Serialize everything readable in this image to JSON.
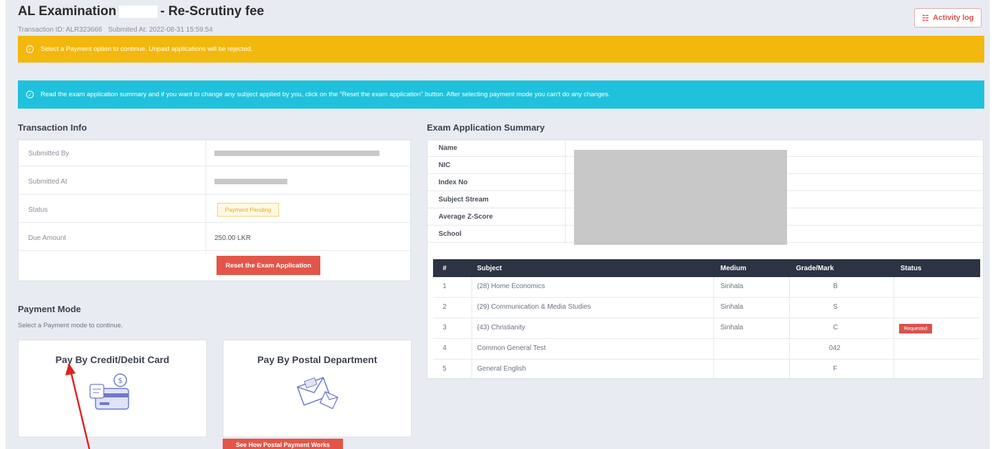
{
  "header": {
    "title_left": "AL Examination",
    "title_right": "- Re-Scrutiny fee",
    "transaction_id": "Transaction ID: ALR323666",
    "submitted_at": "Submited At: 2022-08-31 15:59:54",
    "activity_log_label": "Activity log"
  },
  "alerts": {
    "warning": "Select a Payment option to continue. Unpaid applications will be rejected.",
    "info": "Read the exam application summary and if you want to change any subject applied by you, click on the \"Reset the exam application\" button. After selecting payment mode you can't do any changes."
  },
  "transaction_info": {
    "heading": "Transaction Info",
    "rows": [
      {
        "label": "Submitted By",
        "value": ""
      },
      {
        "label": "Submitted At",
        "value": ""
      },
      {
        "label": "Status",
        "value": "Payment Pending"
      },
      {
        "label": "Due Amount",
        "value": "250.00 LKR"
      }
    ],
    "reset_button": "Reset the Exam Application"
  },
  "payment": {
    "heading": "Payment Mode",
    "hint": "Select a Payment mode to continue.",
    "card_option": "Pay By Credit/Debit Card",
    "postal_option": "Pay By Postal Department",
    "postal_howto_button": "See How Postal Payment Works"
  },
  "summary": {
    "heading": "Exam Application Summary",
    "fields": [
      "Name",
      "NIC",
      "Index No",
      "Subject Stream",
      "Average Z-Score",
      "School"
    ],
    "columns": [
      "#",
      "Subject",
      "Medium",
      "Grade/Mark",
      "Status"
    ],
    "rows": [
      {
        "no": "1",
        "subject": "(28) Home Economics",
        "medium": "Sinhala",
        "grade": "B",
        "status": ""
      },
      {
        "no": "2",
        "subject": "(29) Communication & Media Studies",
        "medium": "Sinhala",
        "grade": "S",
        "status": ""
      },
      {
        "no": "3",
        "subject": "(43) Christianity",
        "medium": "Sinhala",
        "grade": "C",
        "status": "Requested"
      },
      {
        "no": "4",
        "subject": "Common General Test",
        "medium": "",
        "grade": "042",
        "status": ""
      },
      {
        "no": "5",
        "subject": "General English",
        "medium": "",
        "grade": "F",
        "status": ""
      }
    ]
  },
  "colors": {
    "warning": "#f2b80e",
    "info": "#1fc1dd",
    "danger": "#e25649",
    "table_header": "#2c3343"
  }
}
